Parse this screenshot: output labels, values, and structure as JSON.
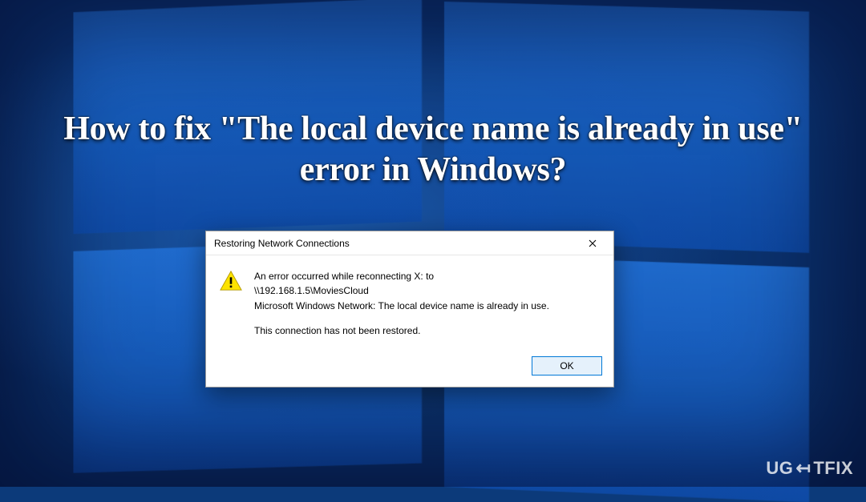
{
  "headline": "How to fix \"The local device name is already in use\" error in Windows?",
  "dialog": {
    "title": "Restoring Network Connections",
    "line1": "An error occurred while reconnecting X: to",
    "line2": "\\\\192.168.1.5\\MoviesCloud",
    "line3": "Microsoft Windows Network: The local device name is already in use.",
    "line4": "This connection has not been restored.",
    "ok_label": "OK"
  },
  "watermark": {
    "pre": "UG",
    "mid": "⇤",
    "post": "TFIX"
  }
}
